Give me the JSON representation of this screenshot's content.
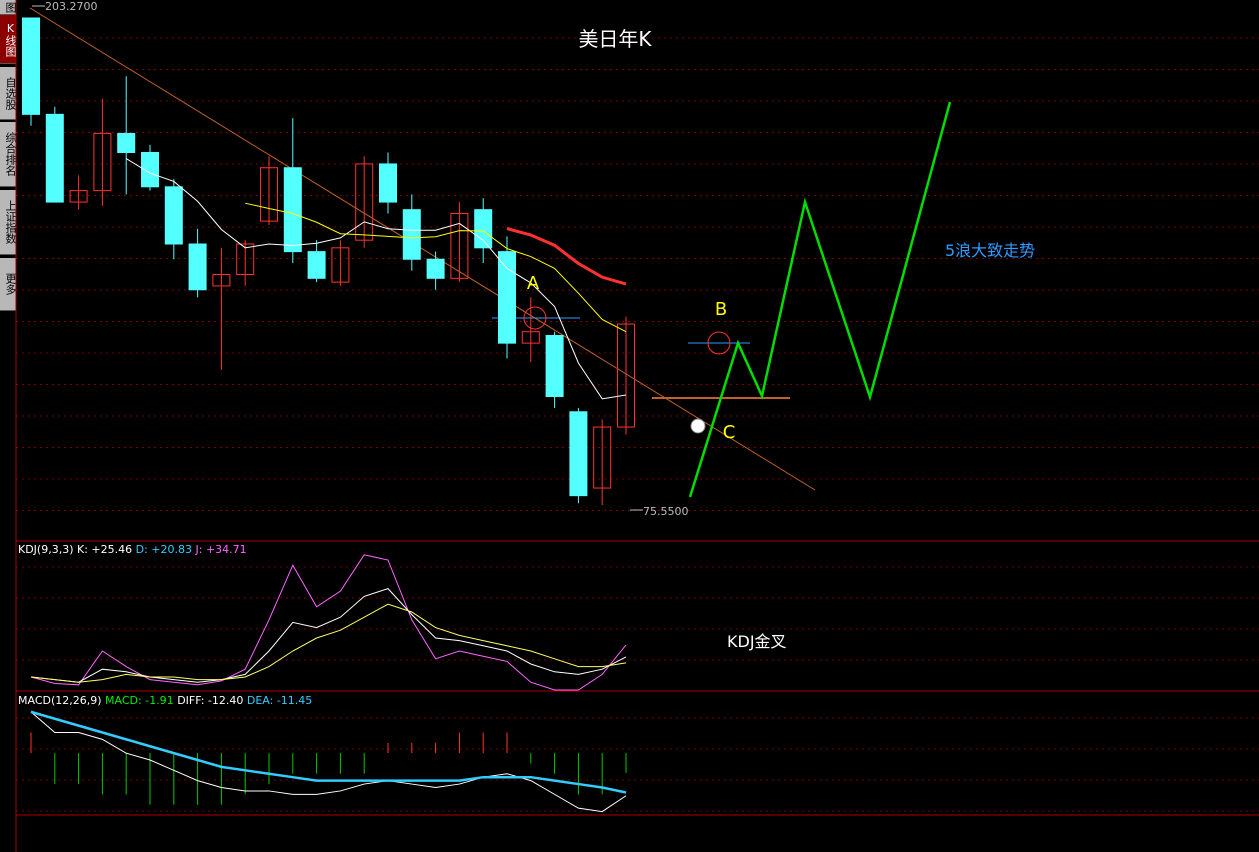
{
  "sidebar": {
    "tabs": [
      {
        "label": "图",
        "active": false
      },
      {
        "label": "K线图",
        "active": true
      },
      {
        "label": "自选股",
        "active": false
      },
      {
        "label": "综合排名",
        "active": false
      },
      {
        "label": "上证指数",
        "active": false
      },
      {
        "label": "更多",
        "active": false
      }
    ]
  },
  "chart_data": {
    "type": "candlestick",
    "title": "美日年K",
    "price_axis_range": [
      75.55,
      203.27
    ],
    "max_label": "203.2700",
    "min_label": "75.5500",
    "annotations": {
      "a": "A",
      "b": "B",
      "c": "C",
      "wave_note": "5浪大致走势",
      "kdj_note": "KDJ金叉"
    },
    "candles": [
      {
        "o": 203.27,
        "h": 203.27,
        "l": 175.0,
        "c": 178.0,
        "up": false
      },
      {
        "o": 178.0,
        "h": 180.0,
        "l": 155.0,
        "c": 155.0,
        "up": false
      },
      {
        "o": 155.0,
        "h": 162.0,
        "l": 153.0,
        "c": 158.0,
        "up": true
      },
      {
        "o": 158.0,
        "h": 182.0,
        "l": 154.0,
        "c": 173.0,
        "up": true
      },
      {
        "o": 173.0,
        "h": 188.0,
        "l": 157.0,
        "c": 168.0,
        "up": false
      },
      {
        "o": 168.0,
        "h": 170.0,
        "l": 158.0,
        "c": 159.0,
        "up": false
      },
      {
        "o": 159.0,
        "h": 161.0,
        "l": 140.0,
        "c": 144.0,
        "up": false
      },
      {
        "o": 144.0,
        "h": 148.0,
        "l": 130.0,
        "c": 132.0,
        "up": false
      },
      {
        "o": 133.0,
        "h": 143.0,
        "l": 111.0,
        "c": 136.0,
        "up": true
      },
      {
        "o": 136.0,
        "h": 145.0,
        "l": 133.0,
        "c": 144.0,
        "up": true
      },
      {
        "o": 150.0,
        "h": 167.0,
        "l": 149.0,
        "c": 164.0,
        "up": true
      },
      {
        "o": 164.0,
        "h": 177.0,
        "l": 139.0,
        "c": 142.0,
        "up": false
      },
      {
        "o": 142.0,
        "h": 145.0,
        "l": 134.0,
        "c": 135.0,
        "up": false
      },
      {
        "o": 134.0,
        "h": 145.0,
        "l": 133.0,
        "c": 143.0,
        "up": true
      },
      {
        "o": 145.0,
        "h": 167.0,
        "l": 143.0,
        "c": 165.0,
        "up": true
      },
      {
        "o": 165.0,
        "h": 168.0,
        "l": 152.0,
        "c": 155.0,
        "up": false
      },
      {
        "o": 153.0,
        "h": 157.0,
        "l": 137.0,
        "c": 140.0,
        "up": false
      },
      {
        "o": 140.0,
        "h": 142.0,
        "l": 132.0,
        "c": 135.0,
        "up": false
      },
      {
        "o": 135.0,
        "h": 155.0,
        "l": 134.0,
        "c": 152.0,
        "up": true
      },
      {
        "o": 153.0,
        "h": 156.0,
        "l": 139.0,
        "c": 143.0,
        "up": false
      },
      {
        "o": 142.0,
        "h": 146.0,
        "l": 114.0,
        "c": 118.0,
        "up": false
      },
      {
        "o": 118.0,
        "h": 130.0,
        "l": 113.0,
        "c": 121.0,
        "up": true
      },
      {
        "o": 120.0,
        "h": 121.0,
        "l": 101.0,
        "c": 104.0,
        "up": false
      },
      {
        "o": 100.0,
        "h": 101.0,
        "l": 76.0,
        "c": 78.0,
        "up": false
      },
      {
        "o": 80.0,
        "h": 98.0,
        "l": 75.55,
        "c": 96.0,
        "up": true
      },
      {
        "o": 96.0,
        "h": 125.0,
        "l": 94.0,
        "c": 123.0,
        "up": true
      }
    ],
    "kdj": {
      "label": "KDJ(9,3,3)",
      "k_text": "K: +25.46",
      "d_text": "D: +20.83",
      "j_text": "J: +34.71",
      "k": [
        10,
        8,
        6,
        16,
        14,
        10,
        8,
        6,
        8,
        12,
        30,
        52,
        48,
        56,
        72,
        78,
        58,
        40,
        38,
        34,
        30,
        20,
        14,
        12,
        16,
        25.46
      ],
      "d": [
        10,
        8,
        6,
        8,
        12,
        10,
        10,
        8,
        8,
        10,
        18,
        30,
        40,
        46,
        56,
        66,
        60,
        48,
        42,
        38,
        34,
        30,
        24,
        18,
        18,
        20.83
      ],
      "j": [
        10,
        5,
        4,
        30,
        18,
        8,
        6,
        4,
        7,
        16,
        54,
        96,
        64,
        76,
        104,
        100,
        54,
        24,
        30,
        26,
        22,
        6,
        0,
        0,
        12,
        34.71
      ],
      "range": [
        0,
        100
      ]
    },
    "macd": {
      "label": "MACD(12,26,9)",
      "macd_text": "MACD: -1.91",
      "diff_text": "DIFF: -12.40",
      "dea_text": "DEA: -11.45",
      "bars": [
        2,
        -3,
        -3,
        -4,
        -4,
        -5,
        -5,
        -5,
        -5,
        -4,
        -3,
        -2,
        -2,
        -2,
        -2,
        1,
        1,
        1,
        2,
        2,
        2,
        -1,
        -2,
        -4,
        -4,
        -1.91
      ],
      "diff": [
        12,
        6,
        6,
        4,
        0,
        -2,
        -5,
        -8,
        -10,
        -11,
        -11,
        -12,
        -12,
        -11,
        -9,
        -8,
        -9,
        -10,
        -9,
        -7,
        -6,
        -8,
        -12,
        -16,
        -17,
        -12.4
      ],
      "dea": [
        12,
        10,
        8,
        6,
        4,
        2,
        0,
        -2,
        -4,
        -5,
        -6,
        -7,
        -8,
        -8,
        -8,
        -8,
        -8,
        -8,
        -8,
        -7,
        -7,
        -7,
        -8,
        -9,
        -10,
        -11.45
      ],
      "range": [
        -18,
        14
      ]
    },
    "colors": {
      "up": "#ff3232",
      "down": "#54ffff",
      "ma_short": "#ffffff",
      "ma_mid": "#ffff00",
      "ma_long": "#ff3232",
      "trend": "#c0622a",
      "wave": "#00dd00",
      "kdj_k": "#ffffff",
      "kdj_d": "#ffff66",
      "kdj_j": "#ff66ff",
      "macd_diff": "#ffffff",
      "macd_dea": "#33ccff"
    }
  }
}
